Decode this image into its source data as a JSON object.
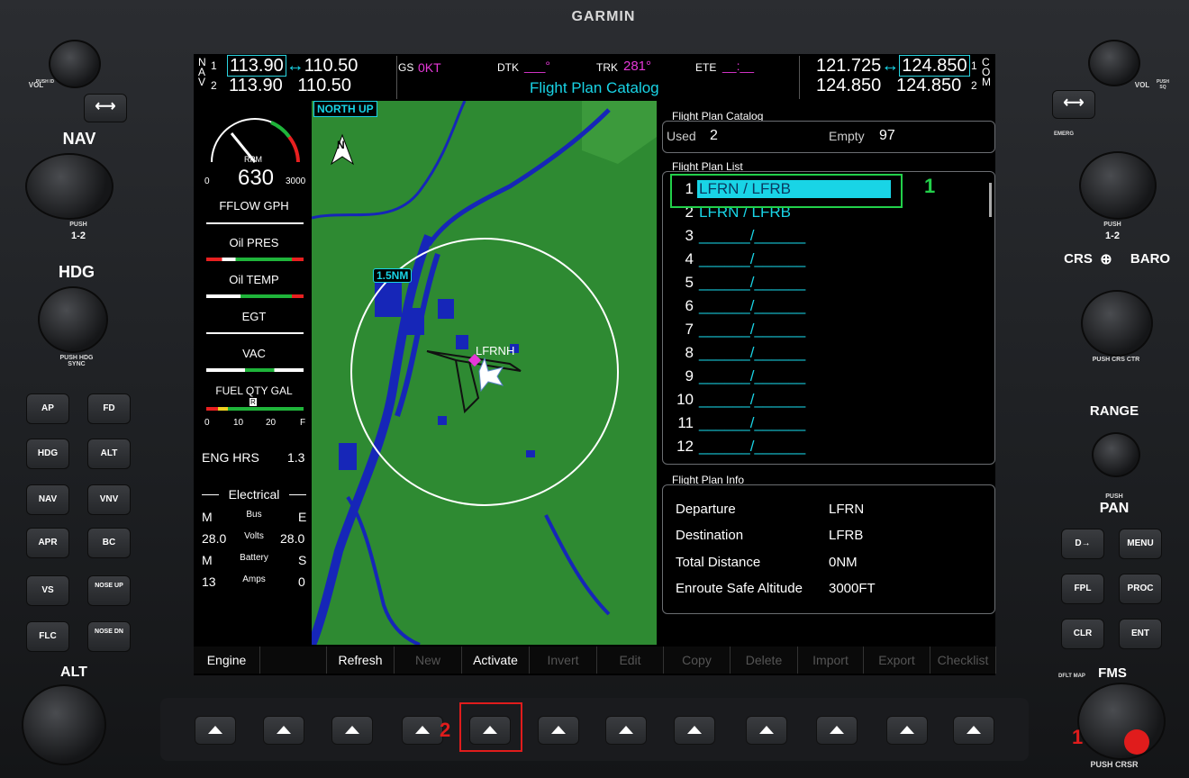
{
  "brand": "GARMIN",
  "top_bar": {
    "nav_label": "N\nA\nV",
    "nav1_index": "1",
    "nav2_index": "2",
    "nav1_active": "113.90",
    "nav1_standby": "110.50",
    "nav2_active": "113.90",
    "nav2_standby": "110.50",
    "swap": "↔",
    "gs_label": "GS",
    "gs_value": "0KT",
    "dtk_label": "DTK",
    "dtk_value": "___°",
    "trk_label": "TRK",
    "trk_value": "281°",
    "ete_label": "ETE",
    "ete_value": "__:__",
    "page_title": "Flight Plan Catalog",
    "com1_active": "121.725",
    "com1_standby": "124.850",
    "com2_active": "124.850",
    "com2_standby": "124.850",
    "com1_index": "1",
    "com2_index": "2",
    "com_label_c": "C",
    "com_label_o": "O",
    "com_label_m": "M"
  },
  "engine": {
    "rpm_label": "RPM",
    "rpm_value": "630",
    "rpm_min": "0",
    "rpm_max": "3000",
    "fflow_label": "FFLOW GPH",
    "oil_pres_label": "Oil PRES",
    "oil_temp_label": "Oil TEMP",
    "egt_label": "EGT",
    "vac_label": "VAC",
    "fuel_label": "FUEL QTY GAL",
    "fuel_ticks": [
      "0",
      "10",
      "20",
      "F"
    ],
    "fuel_marker": "R",
    "eng_hrs_label": "ENG HRS",
    "eng_hrs_value": "1.3",
    "electrical_label": "Electrical",
    "bus_label": "Bus",
    "bus_left": "M",
    "bus_right": "E",
    "volts_label": "Volts",
    "volts_left": "28.0",
    "volts_right": "28.0",
    "battery_label": "Battery",
    "battery_left": "M",
    "battery_right": "S",
    "amps_label": "Amps",
    "amps_left": "13",
    "amps_right": "0"
  },
  "map": {
    "orientation": "NORTH UP",
    "north_label": "N",
    "range": "1.5NM",
    "airport": "LFRNH"
  },
  "catalog": {
    "title": "Flight Plan Catalog",
    "used_label": "Used",
    "used_value": "2",
    "empty_label": "Empty",
    "empty_value": "97"
  },
  "plan_list": {
    "title": "Flight Plan List",
    "rows": [
      {
        "num": "1",
        "name": "LFRN / LFRB"
      },
      {
        "num": "2",
        "name": "LFRN / LFRB"
      },
      {
        "num": "3",
        "name": "______/______"
      },
      {
        "num": "4",
        "name": "______/______"
      },
      {
        "num": "5",
        "name": "______/______"
      },
      {
        "num": "6",
        "name": "______/______"
      },
      {
        "num": "7",
        "name": "______/______"
      },
      {
        "num": "8",
        "name": "______/______"
      },
      {
        "num": "9",
        "name": "______/______"
      },
      {
        "num": "10",
        "name": "______/______"
      },
      {
        "num": "11",
        "name": "______/______"
      },
      {
        "num": "12",
        "name": "______/______"
      }
    ]
  },
  "plan_info": {
    "title": "Flight Plan Info",
    "departure_label": "Departure",
    "departure_value": "LFRN",
    "destination_label": "Destination",
    "destination_value": "LFRB",
    "distance_label": "Total Distance",
    "distance_value": "0NM",
    "esa_label": "Enroute Safe Altitude",
    "esa_value": "3000FT"
  },
  "softkeys": [
    "Engine",
    "",
    "Refresh",
    "New",
    "Activate",
    "Invert",
    "Edit",
    "Copy",
    "Delete",
    "Import",
    "Export",
    "Checklist"
  ],
  "annotations": {
    "step1_list": "1",
    "step2": "2",
    "step1_knob": "1"
  },
  "left_panel": {
    "vol_label": "VOL",
    "vol_push": "PUSH ID",
    "nav_label": "NAV",
    "nav_push": "PUSH",
    "nav_12": "1-2",
    "hdg_label": "HDG",
    "hdg_push": "PUSH HDG SYNC",
    "alt_label": "ALT",
    "buttons": [
      "AP",
      "FD",
      "HDG",
      "ALT",
      "NAV",
      "VNV",
      "APR",
      "BC",
      "VS",
      "NOSE UP",
      "FLC",
      "NOSE DN"
    ]
  },
  "right_panel": {
    "vol_label": "VOL",
    "vol_push": "PUSH SQ",
    "emerg_label": "EMERG",
    "com_push": "PUSH",
    "com_12": "1-2",
    "crs_label": "CRS",
    "baro_label": "BARO",
    "crs_push": "PUSH CRS CTR",
    "range_label": "RANGE",
    "pan_push": "PUSH",
    "pan_label": "PAN",
    "buttons": [
      "D→",
      "MENU",
      "FPL",
      "PROC",
      "CLR",
      "ENT"
    ],
    "dflt_map": "DFLT MAP",
    "fms_label": "FMS",
    "fms_push": "PUSH CRSR"
  },
  "colors": {
    "cyan": "#19d4e6",
    "magenta": "#e638d8",
    "annotation_green": "#22d04a",
    "annotation_red": "#e01c1c"
  }
}
